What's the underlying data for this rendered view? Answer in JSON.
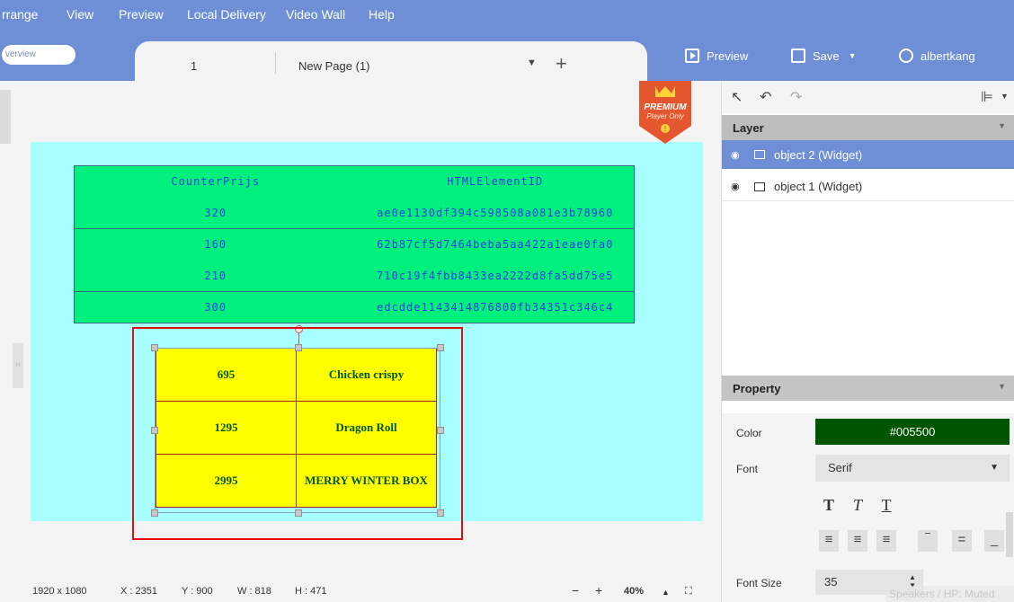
{
  "menu": [
    "rrange",
    "View",
    "Preview",
    "Local Delivery",
    "Video Wall",
    "Help"
  ],
  "tabbar": {
    "overview_label": "verview",
    "page_number": "1",
    "page_name": "New Page (1)",
    "preview_label": "Preview",
    "save_label": "Save",
    "user_label": "albertkang"
  },
  "premium_badge": {
    "line1": "PREMIUM",
    "line2": "Player Only"
  },
  "top_table": {
    "headers": [
      "CounterPrijs",
      "HTMLElementID"
    ],
    "rows": [
      [
        "320",
        "ae0e1130df394c598508a081e3b78960"
      ],
      [
        "160",
        "62b87cf5d7464beba5aa422a1eae0fa0"
      ],
      [
        "210",
        "710c19f4fbb8433ea2222d8fa5dd75e5"
      ],
      [
        "300",
        "edcdde1143414876800fb34351c346c4"
      ]
    ]
  },
  "bottom_table": {
    "rows": [
      [
        "695",
        "Chicken crispy"
      ],
      [
        "1295",
        "Dragon Roll"
      ],
      [
        "2995",
        "MERRY WINTER BOX"
      ]
    ]
  },
  "statusbar": {
    "resolution": "1920 x 1080",
    "x": "X : 2351",
    "y": "Y : 900",
    "w": "W : 818",
    "h": "H : 471",
    "zoom": "40%"
  },
  "layer_panel": {
    "title": "Layer",
    "items": [
      "object 2 (Widget)",
      "object 1 (Widget)"
    ]
  },
  "property_panel": {
    "title": "Property",
    "color_label": "Color",
    "color_value": "#005500",
    "font_label": "Font",
    "font_value": "Serif",
    "font_size_label": "Font Size",
    "font_size_value": "35"
  },
  "toast": "Speakers / HP: Muted",
  "colors": {
    "accent": "#6e8fd6",
    "canvas": "#a8ffff",
    "table_green": "#00f07e",
    "widget_yellow": "#ffff00",
    "text_green": "#005500"
  }
}
